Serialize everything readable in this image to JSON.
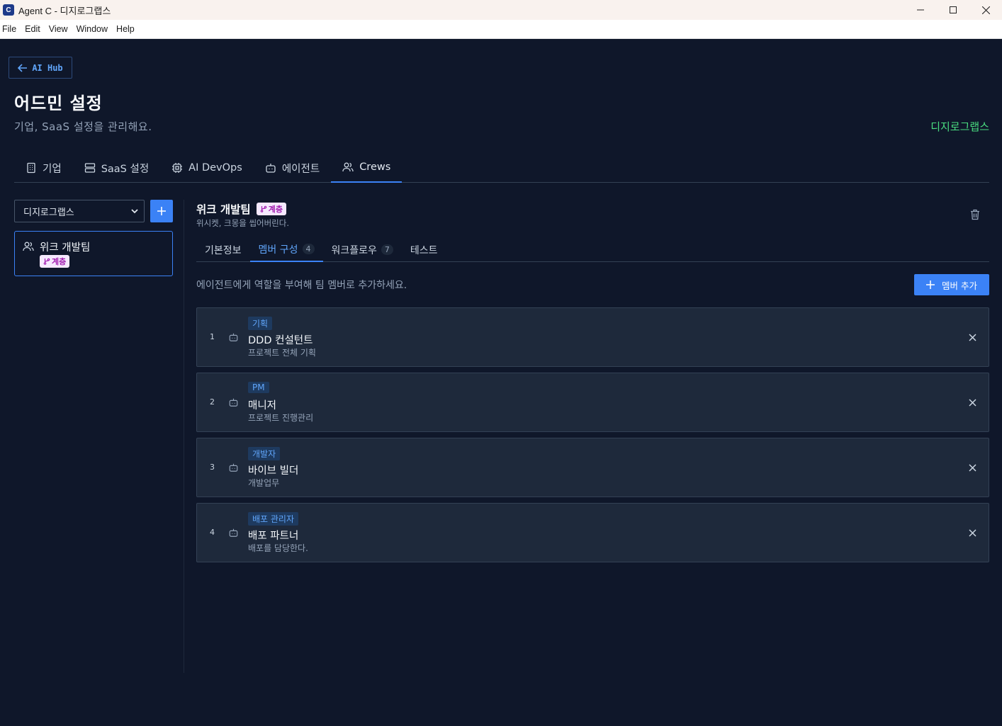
{
  "window": {
    "title": "Agent C - 디지로그랩스",
    "app_icon_letter": "C"
  },
  "menu": [
    "File",
    "Edit",
    "View",
    "Window",
    "Help"
  ],
  "back_button": {
    "label": "AI Hub"
  },
  "page": {
    "title": "어드민 설정",
    "subtitle": "기업, SaaS 설정을 관리해요.",
    "company": "디지로그랩스"
  },
  "main_tabs": [
    {
      "label": "기업",
      "icon": "building-icon"
    },
    {
      "label": "SaaS 설정",
      "icon": "server-icon"
    },
    {
      "label": "AI DevOps",
      "icon": "cpu-icon"
    },
    {
      "label": "에이전트",
      "icon": "bot-icon"
    },
    {
      "label": "Crews",
      "icon": "users-icon",
      "active": true
    }
  ],
  "left": {
    "org_select": "디지로그랩스",
    "crews": [
      {
        "name": "위크 개발팀",
        "badge": "계층"
      }
    ]
  },
  "detail": {
    "title": "위크 개발팀",
    "badge": "계층",
    "description": "위시켓, 크몽을 씹어버린다.",
    "sub_tabs": [
      {
        "label": "기본정보"
      },
      {
        "label": "멤버 구성",
        "count": "4",
        "active": true
      },
      {
        "label": "워크플로우",
        "count": "7"
      },
      {
        "label": "테스트"
      }
    ],
    "hint": "에이전트에게 역할을 부여해 팀 멤버로 추가하세요.",
    "add_member_label": "멤버 추가",
    "members": [
      {
        "index": "1",
        "role": "기획",
        "name": "DDD 컨설턴트",
        "desc": "프로젝트 전체 기획"
      },
      {
        "index": "2",
        "role": "PM",
        "name": "매니저",
        "desc": "프로젝트 진행관리"
      },
      {
        "index": "3",
        "role": "개발자",
        "name": "바이브 빌더",
        "desc": "개발업무"
      },
      {
        "index": "4",
        "role": "배포 관리자",
        "name": "배포 파트너",
        "desc": "배포를 담당한다."
      }
    ]
  },
  "colors": {
    "background": "#0f172a",
    "card": "#1e293b",
    "accent": "#3b82f6",
    "company": "#4ade80",
    "badge_bg": "#f5e9ff",
    "badge_text": "#a21caf"
  }
}
